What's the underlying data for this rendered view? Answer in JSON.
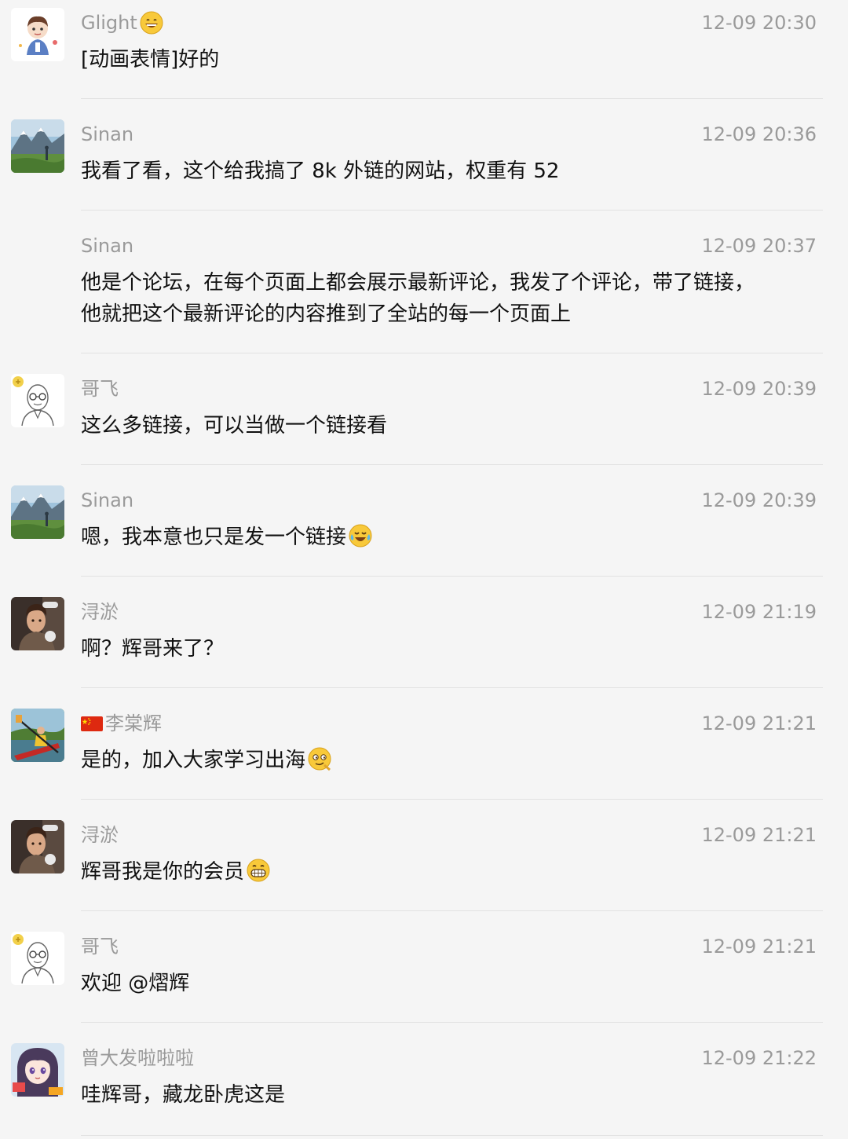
{
  "messages": [
    {
      "name": "Glight",
      "time": "12-09 20:30",
      "text": "[动画表情]好的"
    },
    {
      "name": "Sinan",
      "time": "12-09 20:36",
      "text": "我看了看，这个给我搞了 8k 外链的网站，权重有 52"
    },
    {
      "name": "Sinan",
      "time": "12-09 20:37",
      "text_line1": "他是个论坛，在每个页面上都会展示最新评论，我发了个评论，带了链接，",
      "text_line2": "他就把这个最新评论的内容推到了全站的每一个页面上"
    },
    {
      "name": "哥飞",
      "time": "12-09 20:39",
      "text": "这么多链接，可以当做一个链接看"
    },
    {
      "name": "Sinan",
      "time": "12-09 20:39",
      "text": "嗯，我本意也只是发一个链接"
    },
    {
      "name": "浔淤",
      "time": "12-09 21:19",
      "text": "啊？辉哥来了？"
    },
    {
      "name": "李棠辉",
      "time": "12-09 21:21",
      "text": "是的，加入大家学习出海"
    },
    {
      "name": "浔淤",
      "time": "12-09 21:21",
      "text": "辉哥我是你的会员"
    },
    {
      "name": "哥飞",
      "time": "12-09 21:21",
      "text": "欢迎 @熠辉"
    },
    {
      "name": "曾大发啦啦啦",
      "time": "12-09 21:22",
      "text": "哇辉哥，藏龙卧虎这是"
    }
  ],
  "icons": {
    "glight_name_emoji": "grin-emoji-icon",
    "sinan_emoji": "laugh-cry-emoji-icon",
    "li_flag": "china-flag-icon",
    "li_emoji": "smirk-emoji-icon",
    "xunyu_emoji": "big-grin-emoji-icon"
  },
  "colors": {
    "background": "#f5f5f5",
    "meta_text": "#9a9a9a",
    "body_text": "#111111",
    "divider": "#e2e2e2"
  }
}
